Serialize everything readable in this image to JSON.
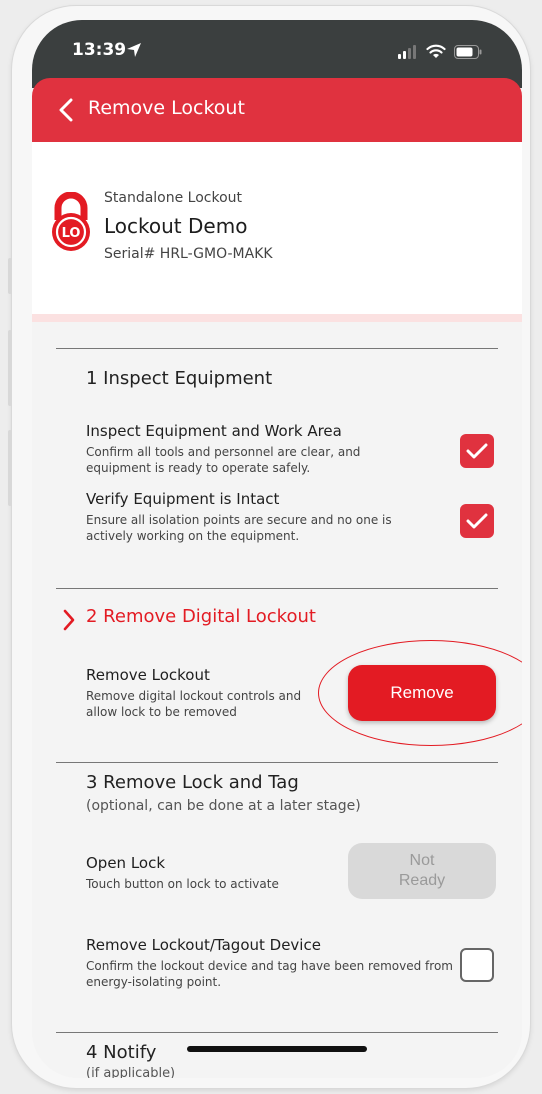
{
  "status_bar": {
    "time": "13:39"
  },
  "header": {
    "title": "Remove Lockout"
  },
  "lock": {
    "type": "Standalone Lockout",
    "name": "Lockout Demo",
    "serial": "Serial# HRL-GMO-MAKK",
    "badge": "LO"
  },
  "sections": {
    "inspect": {
      "title": "1 Inspect Equipment",
      "items": [
        {
          "title": "Inspect Equipment and Work Area",
          "desc": "Confirm all tools and personnel are clear, and equipment is ready to operate safely.",
          "checked": true
        },
        {
          "title": "Verify Equipment is Intact",
          "desc": "Ensure all isolation points are secure and no one is actively working on the equipment.",
          "checked": true
        }
      ]
    },
    "remove_digital": {
      "title": "2 Remove Digital Lockout",
      "item_title": "Remove Lockout",
      "item_desc": "Remove digital lockout controls and allow lock to be removed",
      "button": "Remove"
    },
    "remove_lock": {
      "title": "3 Remove Lock and Tag",
      "subtitle": "(optional, can be done at a later stage)",
      "open_lock_title": "Open Lock",
      "open_lock_desc": "Touch button on lock to activate",
      "not_ready_line1": "Not",
      "not_ready_line2": "Ready",
      "device_title": "Remove Lockout/Tagout Device",
      "device_desc": "Confirm the lockout device and tag have been removed from energy-isolating point.",
      "device_checked": false
    },
    "notify": {
      "title": "4 Notify",
      "subtitle": "(if applicable)"
    }
  },
  "colors": {
    "accent": "#e31b23",
    "header": "#e0323f",
    "status_bar": "#3b3f3f"
  }
}
